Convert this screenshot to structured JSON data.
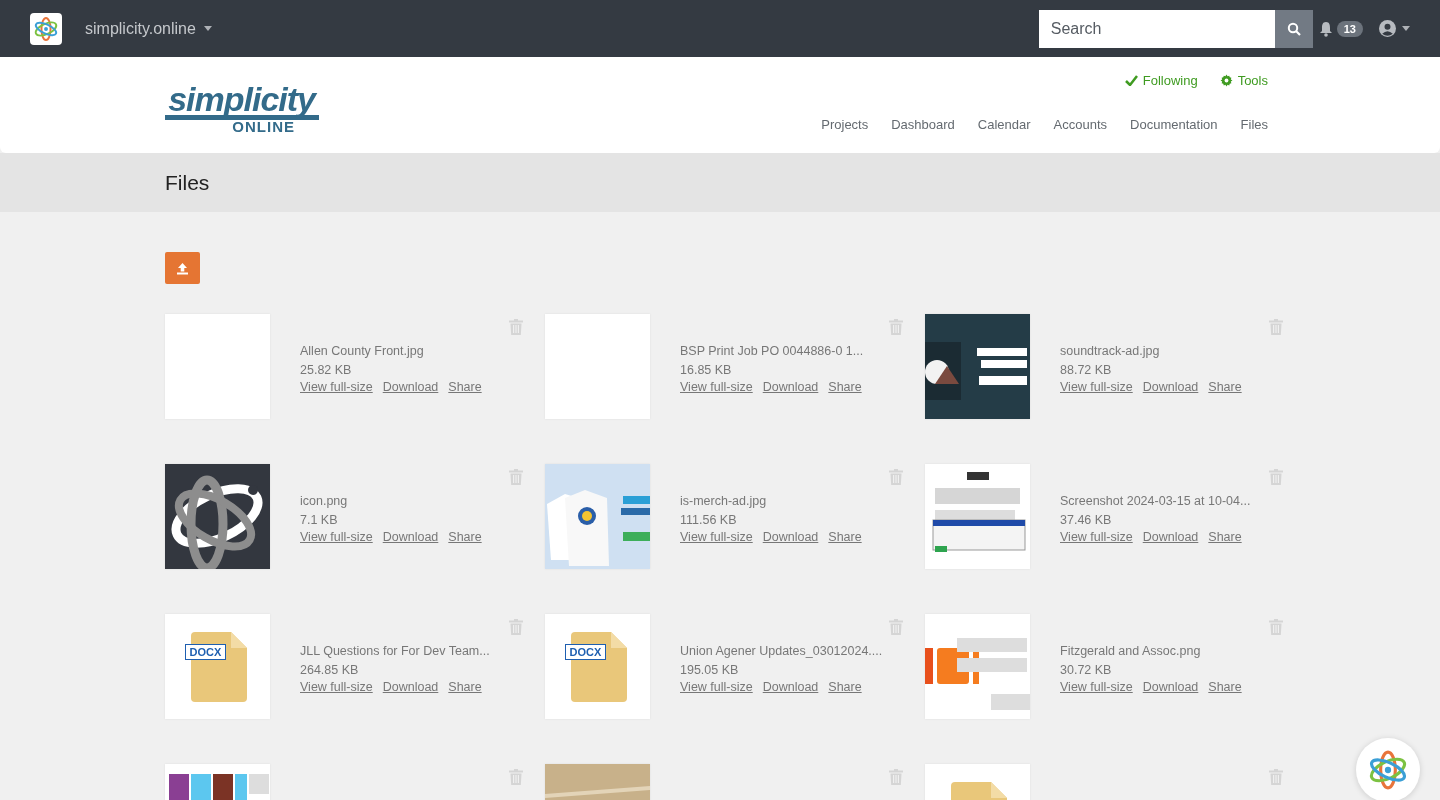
{
  "topbar": {
    "site": "simplicity.online",
    "search": {
      "placeholder": "Search"
    },
    "notifications": "13"
  },
  "header": {
    "logo": {
      "text": "simplicity",
      "subtext": "ONLINE"
    },
    "actions": [
      {
        "kind": "check",
        "label": "Following"
      },
      {
        "kind": "gear",
        "label": "Tools"
      }
    ],
    "nav": [
      {
        "label": "Projects"
      },
      {
        "label": "Dashboard"
      },
      {
        "label": "Calendar"
      },
      {
        "label": "Accounts"
      },
      {
        "label": "Documentation"
      },
      {
        "label": "Files"
      }
    ]
  },
  "page_title": "Files",
  "files": [
    {
      "name": "Allen County Front.jpg",
      "size": "25.82 KB",
      "thumb": {
        "kind": "blank"
      },
      "actions": [
        "View full-size",
        "Download",
        "Share"
      ]
    },
    {
      "name": "BSP Print Job PO 0044886-0 1...",
      "size": "16.85 KB",
      "thumb": {
        "kind": "blank"
      },
      "actions": [
        "View full-size",
        "Download",
        "Share"
      ]
    },
    {
      "name": "soundtrack-ad.jpg",
      "size": "88.72 KB",
      "thumb": {
        "kind": "picture"
      },
      "actions": [
        "View full-size",
        "Download",
        "Share"
      ]
    },
    {
      "name": "icon.png",
      "size": "7.1 KB",
      "thumb": {
        "kind": "picture"
      },
      "actions": [
        "View full-size",
        "Download",
        "Share"
      ]
    },
    {
      "name": "is-merch-ad.jpg",
      "size": "111.56 KB",
      "thumb": {
        "kind": "picture"
      },
      "actions": [
        "View full-size",
        "Download",
        "Share"
      ]
    },
    {
      "name": "Screenshot 2024-03-15 at 10-04...",
      "size": "37.46 KB",
      "thumb": {
        "kind": "picture"
      },
      "actions": [
        "View full-size",
        "Download",
        "Share"
      ]
    },
    {
      "name": "JLL Questions for For Dev Team...",
      "size": "264.85 KB",
      "thumb": {
        "kind": "doc",
        "badge": "DOCX"
      },
      "actions": [
        "View full-size",
        "Download",
        "Share"
      ]
    },
    {
      "name": "Union Agener Updates_03012024....",
      "size": "195.05 KB",
      "thumb": {
        "kind": "doc",
        "badge": "DOCX"
      },
      "actions": [
        "View full-size",
        "Download",
        "Share"
      ]
    },
    {
      "name": "Fitzgerald and Assoc.png",
      "size": "30.72 KB",
      "thumb": {
        "kind": "picture"
      },
      "actions": [
        "View full-size",
        "Download",
        "Share"
      ]
    },
    {
      "thumb": {
        "kind": "picture"
      }
    },
    {
      "thumb": {
        "kind": "picture"
      }
    },
    {
      "thumb": {
        "kind": "doc"
      }
    }
  ]
}
